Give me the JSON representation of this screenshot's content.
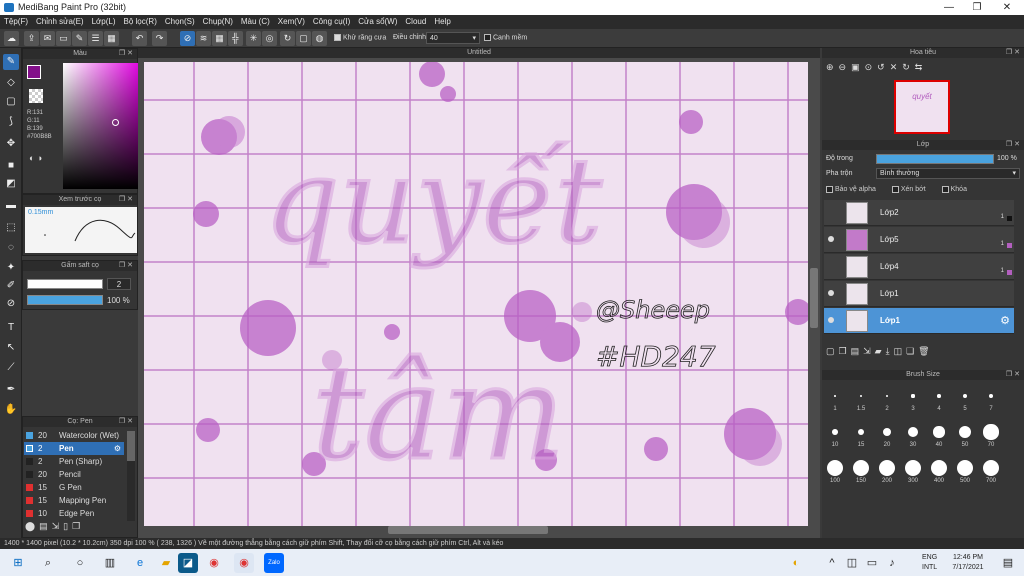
{
  "window": {
    "title": "MediBang Paint Pro (32bit)",
    "min": "—",
    "max": "❐",
    "close": "✕"
  },
  "menu": [
    "Tệp(F)",
    "Chỉnh sửa(E)",
    "Lớp(L)",
    "Bộ lọc(R)",
    "Chọn(S)",
    "Chụp(N)",
    "Màu (C)",
    "Xem(V)",
    "Công cụ(I)",
    "Cửa sổ(W)",
    "Cloud",
    "Help"
  ],
  "toolbar": {
    "antialias_label": "Khử răng cưa",
    "adjust_label": "Điều chỉnh",
    "adjust_value": "40",
    "snap_label": "Canh mềm"
  },
  "color_panel": {
    "title": "Màu",
    "r": "R:131",
    "g": "G:11",
    "b": "B:139",
    "hex": "#700B8B",
    "primary": "#83108a"
  },
  "brush_preview": {
    "title": "Xem trước cọ",
    "size": "0.15mm"
  },
  "opacity_panel": {
    "title": "Gấm saft cọ",
    "size_value": "2",
    "opacity_value": "100 %"
  },
  "brush_list": {
    "title": "Cọ: Pen",
    "items": [
      {
        "size": "20",
        "name": "Watercolor (Wet)",
        "color": "#4aa3df"
      },
      {
        "size": "2",
        "name": "Pen",
        "color": "#4aa3df",
        "selected": true
      },
      {
        "size": "2",
        "name": "Pen (Sharp)",
        "color": "#222222"
      },
      {
        "size": "20",
        "name": "Pencil",
        "color": "#222222"
      },
      {
        "size": "15",
        "name": "G Pen",
        "color": "#e03030"
      },
      {
        "size": "15",
        "name": "Mapping Pen",
        "color": "#e03030"
      },
      {
        "size": "10",
        "name": "Edge Pen",
        "color": "#e03030"
      }
    ]
  },
  "canvas": {
    "title": "Untitled",
    "text_main1": "quyết",
    "text_main2": "tâm",
    "text_sign1": "@Sheeep",
    "text_sign2": "#HD247"
  },
  "navigator": {
    "title": "Hoa tiêu"
  },
  "layers_panel": {
    "title": "Lớp",
    "opacity_label": "Độ trong",
    "opacity_value": "100 %",
    "blend_label": "Pha trộn",
    "blend_value": "Bình thường",
    "protect_alpha": "Bảo vệ alpha",
    "clipping": "Xén bớt",
    "lock": "Khóa",
    "layers": [
      {
        "name": "Lớp2",
        "num": "1"
      },
      {
        "name": "Lớp5",
        "num": "1"
      },
      {
        "name": "Lớp4",
        "num": "1"
      },
      {
        "name": "Lớp1",
        "num": ""
      },
      {
        "name": "Lớp1",
        "num": "",
        "selected": true
      }
    ]
  },
  "brush_size": {
    "title": "Brush Size",
    "values": [
      "1",
      "1.5",
      "2",
      "3",
      "4",
      "5",
      "7",
      "10",
      "15",
      "20",
      "30",
      "40",
      "50",
      "70",
      "100",
      "150",
      "200",
      "300",
      "400",
      "500",
      "700"
    ]
  },
  "status": "1400 * 1400 pixel  (10.2 * 10.2cm)  350 dpi  100 %  ( 238, 1326 )  Vẽ một đường thẳng bằng cách giữ phím Shift, Thay đổi cỡ cọ bằng cách giữ phím Ctrl, Alt và kéo",
  "taskbar": {
    "lang1": "ENG",
    "lang2": "INTL",
    "time": "12:46 PM",
    "date": "7/17/2021"
  }
}
